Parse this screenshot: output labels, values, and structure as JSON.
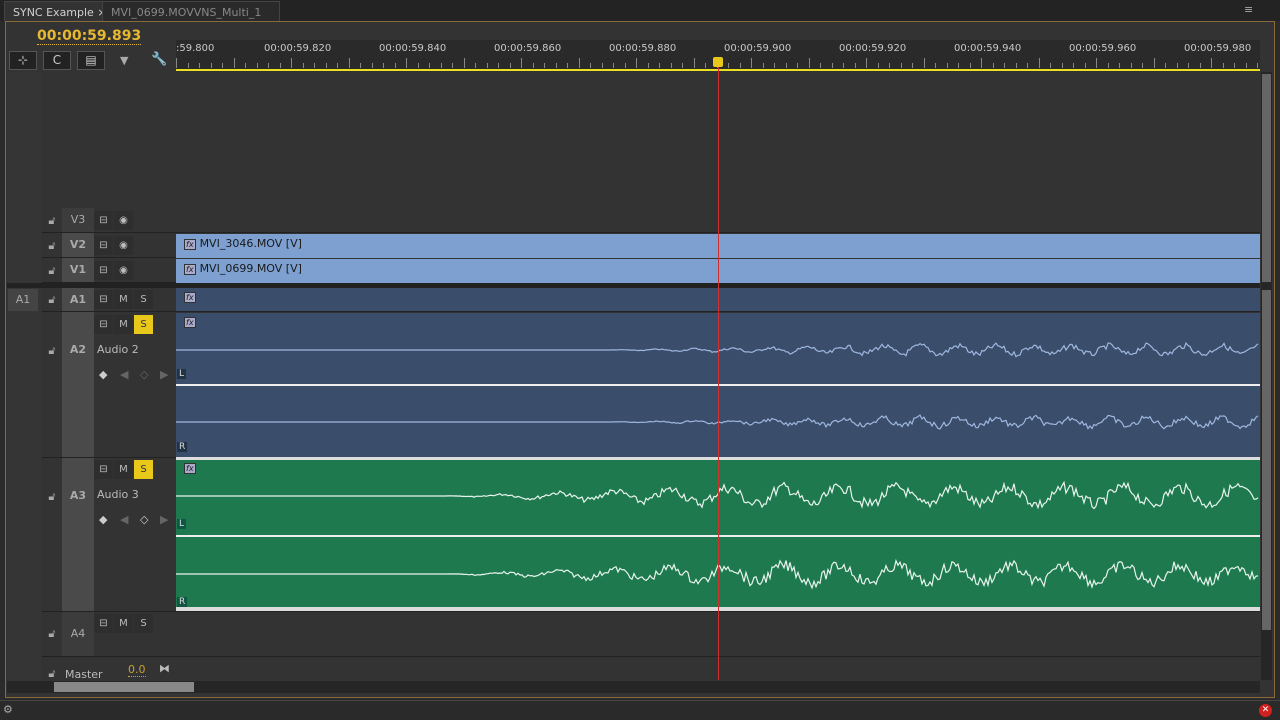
{
  "tabs": [
    {
      "label": "SYNC Example",
      "close": "×"
    },
    {
      "label": "MVI_0699.MOVVNS_Multi_1"
    }
  ],
  "timecode": "00:00:59.893",
  "ruler_labels": [
    ":59.800",
    "00:00:59.820",
    "00:00:59.840",
    "00:00:59.860",
    "00:00:59.880",
    "00:00:59.900",
    "00:00:59.920",
    "00:00:59.940",
    "00:00:59.960",
    "00:00:59.980"
  ],
  "source_patch": "A1",
  "tracks": {
    "v3": {
      "name": "V3"
    },
    "v2": {
      "name": "V2",
      "clip": "MVI_3046.MOV [V]"
    },
    "v1": {
      "name": "V1",
      "clip": "MVI_0699.MOV [V]"
    },
    "a1": {
      "name": "A1"
    },
    "a2": {
      "name": "A2",
      "label": "Audio 2",
      "solo": true
    },
    "a3": {
      "name": "A3",
      "label": "Audio 3",
      "solo": true
    },
    "a4": {
      "name": "A4"
    },
    "master": {
      "name": "Master",
      "value": "0.0"
    }
  },
  "buttons": {
    "m": "M",
    "s": "S",
    "fx": "fx",
    "l": "L",
    "r": "R"
  },
  "colors": {
    "video_clip": "#7da0d0",
    "audio2_clip": "#3a4d6a",
    "audio3_clip": "#1e7a4e",
    "playhead": "#d03030",
    "timecode": "#e8b830",
    "solo": "#e8c81a"
  }
}
